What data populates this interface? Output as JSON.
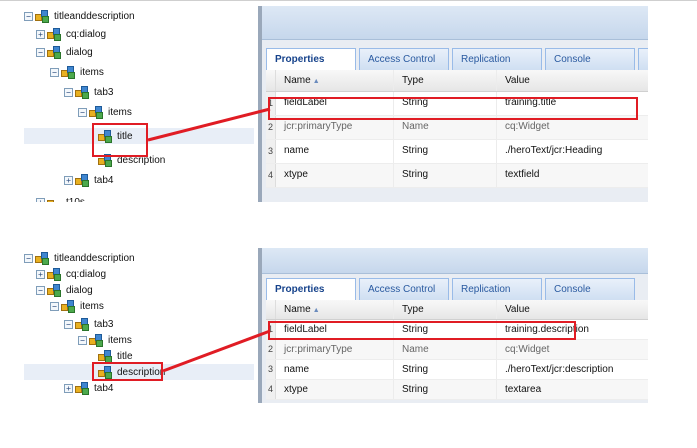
{
  "panels": [
    {
      "tree": {
        "nodes": [
          {
            "label": "titleanddescription",
            "exp": "−",
            "depth": 0
          },
          {
            "label": "cq:dialog",
            "exp": "+",
            "depth": 1
          },
          {
            "label": "dialog",
            "exp": "−",
            "depth": 1
          },
          {
            "label": "items",
            "exp": "−",
            "depth": 2
          },
          {
            "label": "tab3",
            "exp": "−",
            "depth": 3
          },
          {
            "label": "items",
            "exp": "−",
            "depth": 4
          },
          {
            "label": "title",
            "exp": "",
            "depth": 5
          },
          {
            "label": "description",
            "exp": "",
            "depth": 5
          },
          {
            "label": "tab4",
            "exp": "+",
            "depth": 3
          }
        ],
        "cut_label": "t10s",
        "selected": "title"
      },
      "tabs": [
        "Properties",
        "Access Control",
        "Replication",
        "Console",
        ""
      ],
      "columns": {
        "name": "Name",
        "type": "Type",
        "value": "Value"
      },
      "rows": [
        {
          "n": "1",
          "name": "fieldLabel",
          "type": "String",
          "value": "training.title"
        },
        {
          "n": "2",
          "name": "jcr:primaryType",
          "type": "Name",
          "value": "cq:Widget"
        },
        {
          "n": "3",
          "name": "name",
          "type": "String",
          "value": "./heroText/jcr:Heading"
        },
        {
          "n": "4",
          "name": "xtype",
          "type": "String",
          "value": "textfield"
        }
      ]
    },
    {
      "tree": {
        "nodes": [
          {
            "label": "titleanddescription",
            "exp": "−",
            "depth": 0
          },
          {
            "label": "cq:dialog",
            "exp": "+",
            "depth": 1
          },
          {
            "label": "dialog",
            "exp": "−",
            "depth": 1
          },
          {
            "label": "items",
            "exp": "−",
            "depth": 2
          },
          {
            "label": "tab3",
            "exp": "−",
            "depth": 3
          },
          {
            "label": "items",
            "exp": "−",
            "depth": 4
          },
          {
            "label": "title",
            "exp": "",
            "depth": 5
          },
          {
            "label": "description",
            "exp": "",
            "depth": 5
          },
          {
            "label": "tab4",
            "exp": "+",
            "depth": 3
          }
        ],
        "cut_label": "",
        "selected": "description"
      },
      "tabs": [
        "Properties",
        "Access Control",
        "Replication",
        "Console"
      ],
      "columns": {
        "name": "Name",
        "type": "Type",
        "value": "Value"
      },
      "rows": [
        {
          "n": "1",
          "name": "fieldLabel",
          "type": "String",
          "value": "training.description"
        },
        {
          "n": "2",
          "name": "jcr:primaryType",
          "type": "Name",
          "value": "cq:Widget"
        },
        {
          "n": "3",
          "name": "name",
          "type": "String",
          "value": "./heroText/jcr:description"
        },
        {
          "n": "4",
          "name": "xtype",
          "type": "String",
          "value": "textarea"
        }
      ]
    }
  ],
  "highlight_color": "#e01c24",
  "sort_icon": "sort-ascending-icon"
}
